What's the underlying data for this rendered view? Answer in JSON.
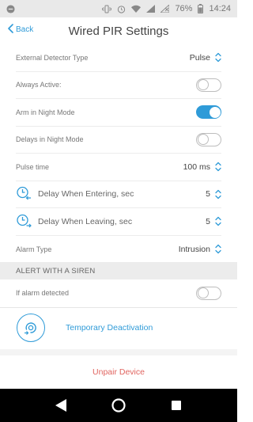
{
  "status_bar": {
    "battery_percent": "76%",
    "time": "14:24"
  },
  "header": {
    "back_label": "Back",
    "title": "Wired PIR Settings"
  },
  "settings": {
    "external_detector_type": {
      "label": "External Detector Type",
      "value": "Pulse"
    },
    "always_active": {
      "label": "Always Active:",
      "on": false
    },
    "arm_in_night_mode": {
      "label": "Arm in Night Mode",
      "on": true
    },
    "delays_in_night_mode": {
      "label": "Delays in Night Mode",
      "on": false
    },
    "pulse_time": {
      "label": "Pulse time",
      "value": "100 ms"
    },
    "delay_entering": {
      "label": "Delay When Entering, sec",
      "value": "5"
    },
    "delay_leaving": {
      "label": "Delay When Leaving, sec",
      "value": "5"
    },
    "alarm_type": {
      "label": "Alarm Type",
      "value": "Intrusion"
    }
  },
  "siren_section": {
    "header": "ALERT WITH A SIREN",
    "if_alarm_detected": {
      "label": "If alarm detected",
      "on": false
    }
  },
  "actions": {
    "temporary_deactivation": "Temporary Deactivation",
    "unpair_device": "Unpair Device"
  },
  "colors": {
    "accent": "#2f9bd8",
    "danger": "#e0645f",
    "section_bg": "#ececec"
  }
}
